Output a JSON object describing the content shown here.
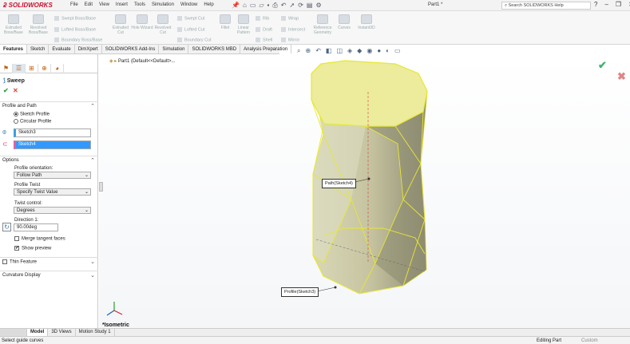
{
  "app": {
    "logo_text": "SOLIDWORKS",
    "doc_title": "Part1 *",
    "search_placeholder": "Search SOLIDWORKS Help",
    "accent": "#c8102e"
  },
  "menu": [
    "File",
    "Edit",
    "View",
    "Insert",
    "Tools",
    "Simulation",
    "Window",
    "Help"
  ],
  "ribbon": {
    "big_buttons": [
      "Extruded Boss/Base",
      "Revolved Boss/Base",
      "Extruded Cut",
      "Hole Wizard",
      "Revolved Cut",
      "Fillet",
      "Linear Pattern",
      "Reference Geometry",
      "Curves",
      "Instant3D"
    ],
    "small_buttons": [
      "Swept Boss/Base",
      "Lofted Boss/Base",
      "Boundary Boss/Base",
      "Swept Cut",
      "Lofted Cut",
      "Boundary Cut",
      "Rib",
      "Draft",
      "Shell",
      "Wrap",
      "Intersect",
      "Mirror"
    ]
  },
  "tabs": [
    "Features",
    "Sketch",
    "Evaluate",
    "DimXpert",
    "SOLIDWORKS Add-Ins",
    "Simulation",
    "SOLIDWORKS MBD",
    "Analysis Preparation"
  ],
  "panel": {
    "title": "Sweep",
    "ok": "✔",
    "cancel": "✕",
    "profile_path": {
      "header": "Profile and Path",
      "opt1": "Sketch Profile",
      "opt2": "Circular Profile",
      "profile_value": "Sketch3",
      "path_value": "Sketch4"
    },
    "options": {
      "header": "Options",
      "orientation_label": "Profile orientation:",
      "orientation_value": "Follow Path",
      "twist_label": "Profile Twist",
      "twist_value": "Specify Twist Value",
      "control_label": "Twist control:",
      "control_value": "Degrees",
      "direction_label": "Direction 1:",
      "direction_value": "90.00deg",
      "merge_label": "Merge tangent faces",
      "preview_label": "Show preview",
      "preview_checked": "✔"
    },
    "thin_feature": "Thin Feature",
    "curvature_display": "Curvature Display"
  },
  "graphics": {
    "tree_label": "Part1  (Default<<Default>...",
    "path_callout": "Path(Sketch4)",
    "profile_callout": "Profile(Sketch3)",
    "view_name": "*Isometric",
    "accept": "✔",
    "reject": "✖"
  },
  "bottom_tabs": [
    "Model",
    "3D Views",
    "Motion Study 1"
  ],
  "status": {
    "left": "Select guide curves",
    "editing": "Editing Part",
    "custom": "Custom"
  }
}
